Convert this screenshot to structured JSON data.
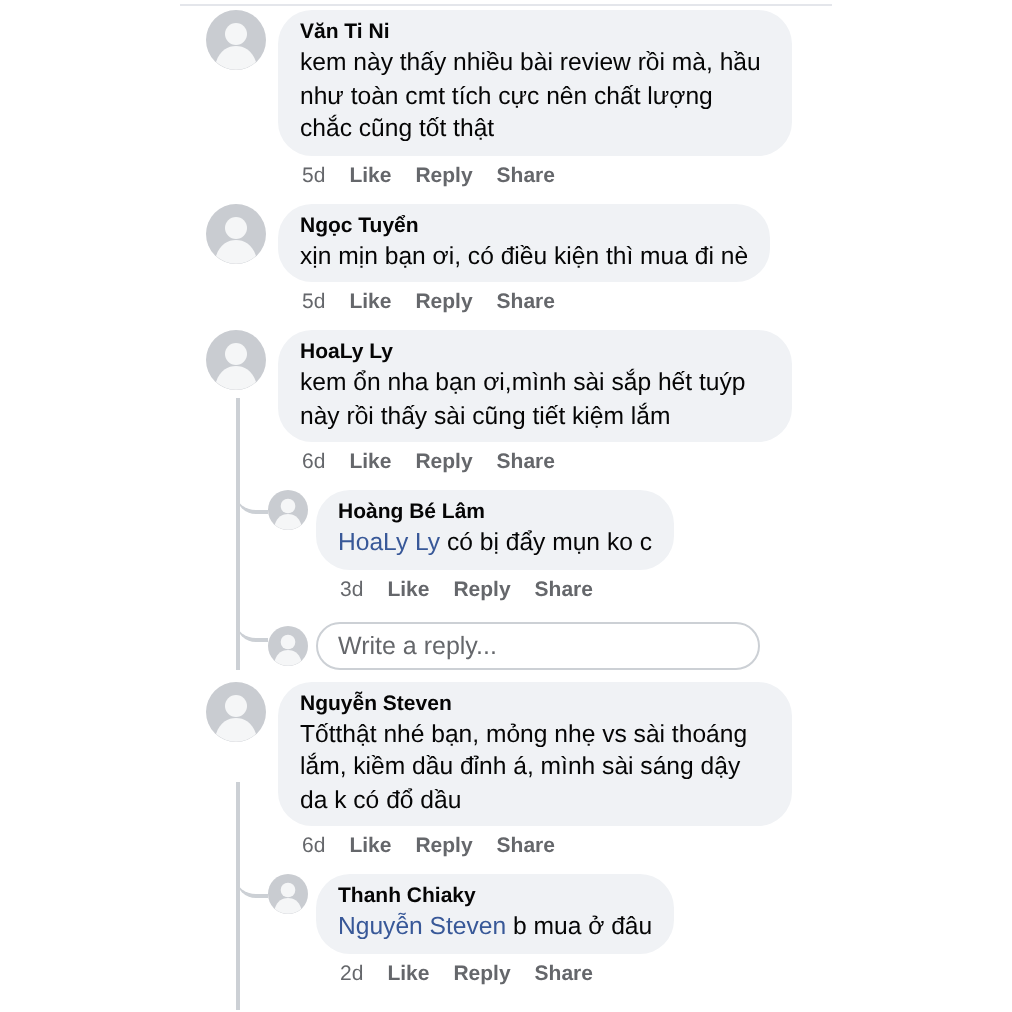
{
  "comments": [
    {
      "name": "Văn Ti Ni",
      "text": "kem này thấy nhiều bài review rồi mà, hầu như toàn cmt tích cực nên chất lượng chắc cũng tốt thật",
      "time": "5d",
      "actions": [
        "Like",
        "Reply",
        "Share"
      ]
    },
    {
      "name": "Ngọc Tuyển",
      "text": "xịn mịn bạn ơi, có điều kiện thì mua đi nè",
      "time": "5d",
      "actions": [
        "Like",
        "Reply",
        "Share"
      ]
    },
    {
      "name": "HoaLy Ly",
      "text": "kem ổn nha bạn ơi,mình sài sắp hết tuýp này rồi thấy sài cũng tiết kiệm lắm",
      "time": "6d",
      "actions": [
        "Like",
        "Reply",
        "Share"
      ],
      "replies": [
        {
          "name": "Hoàng Bé Lâm",
          "mention": "HoaLy Ly",
          "text": "có bị đẩy mụn ko c",
          "time": "3d",
          "actions": [
            "Like",
            "Reply",
            "Share"
          ]
        }
      ],
      "reply_box": {
        "placeholder": "Write a reply..."
      }
    },
    {
      "name": "Nguyễn Steven",
      "text": "Tốtthật nhé bạn, mỏng nhẹ vs sài thoáng lắm, kiềm dầu đỉnh á, mình sài sáng dậy da k có đổ dầu",
      "time": "6d",
      "actions": [
        "Like",
        "Reply",
        "Share"
      ],
      "replies": [
        {
          "name": "Thanh Chiaky",
          "mention": "Nguyễn Steven",
          "text": "b mua ở đâu",
          "time": "2d",
          "actions": [
            "Like",
            "Reply",
            "Share"
          ]
        }
      ]
    }
  ]
}
